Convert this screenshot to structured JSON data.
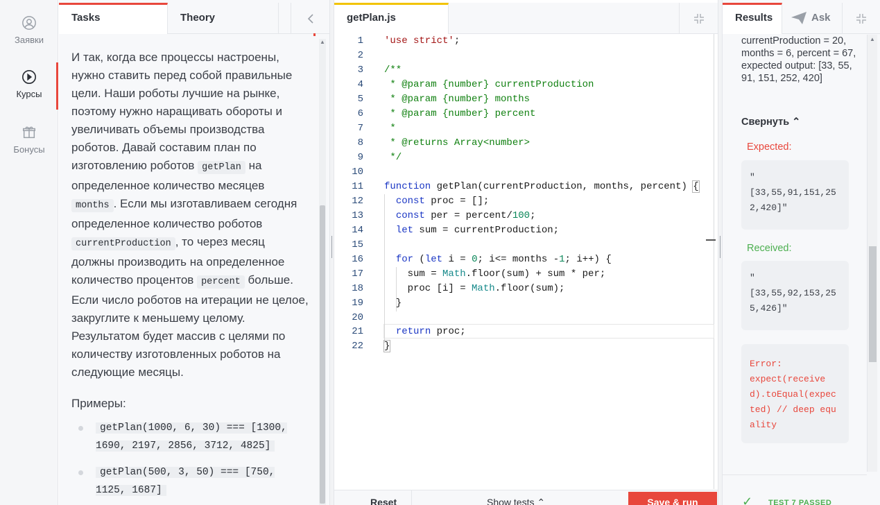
{
  "nav": {
    "items": [
      {
        "label": "Заявки",
        "icon": "user-circle-icon"
      },
      {
        "label": "Курсы",
        "icon": "play-circle-icon",
        "active": true
      },
      {
        "label": "Бонусы",
        "icon": "gift-icon"
      }
    ]
  },
  "tasks": {
    "tab_tasks": "Tasks",
    "tab_theory": "Theory",
    "text_parts": {
      "p1": "И так, когда все процессы настроены, нужно ставить перед собой правильные цели. Наши роботы лучшие на рынке, поэтому нужно наращивать обороты и увеличивать объемы производства роботов. Давай составим план по изготовлению роботов ",
      "c1": "getPlan",
      "p2": " на определенное количество месяцев ",
      "c2": "months",
      "p3": ". Если мы изготавливаем сегодня определенное количество роботов ",
      "c3": "currentProduction",
      "p4": ", то через месяц должны производить на определенное количество процентов ",
      "c4": "percent",
      "p5": " больше. Если число роботов на итерации не целое, закруглите к меньшему целому. Результатом будет массив с целями по количеству изготовленных роботов на следующие месяцы."
    },
    "examples_title": "Примеры:",
    "examples": [
      "getPlan(1000, 6, 30) === [1300, 1690, 2197, 2856, 3712, 4825]",
      "getPlan(500, 3, 50) === [750, 1125, 1687]"
    ]
  },
  "editor": {
    "tab": "getPlan.js",
    "line_numbers": [
      "1",
      "2",
      "3",
      "4",
      "5",
      "6",
      "7",
      "8",
      "9",
      "10",
      "11",
      "12",
      "13",
      "14",
      "15",
      "16",
      "17",
      "18",
      "19",
      "20",
      "21",
      "22"
    ],
    "reset_label": "Reset",
    "show_tests_label": "Show tests",
    "save_run_label": "Save & run"
  },
  "results": {
    "tab_results": "Results",
    "tab_ask": "Ask",
    "description": "currentProduction = 20, months = 6, percent = 67, expected output: [33, 55, 91, 151, 252, 420]",
    "collapse_label": "Свернуть",
    "expected_label": "Expected:",
    "expected_value": "\"\n[33,55,91,151,252,420]\"",
    "received_label": "Received:",
    "received_value": "\"\n[33,55,92,153,255,426]\"",
    "error_value": "Error:\nexpect(received).toEqual(expected) // deep equality",
    "footer_status": "TEST 7 PASSED"
  },
  "colors": {
    "accent": "#e8473c",
    "editor_tab": "#f2c300",
    "success": "#4caf50"
  }
}
